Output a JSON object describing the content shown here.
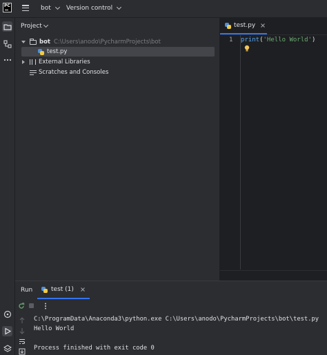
{
  "app": {
    "logo_text": "PC"
  },
  "topbar": {
    "project_name": "bot",
    "vcs_label": "Version control"
  },
  "project_panel": {
    "title": "Project",
    "tree": {
      "root_name": "bot",
      "root_path": "C:\\Users\\anodo\\PycharmProjects\\bot",
      "file_name": "test.py",
      "external_libraries": "External Libraries",
      "scratches": "Scratches and Consoles"
    }
  },
  "editor": {
    "tab_label": "test.py",
    "line_number": "1",
    "code_func": "print",
    "code_open": "(",
    "code_string": "'Hello World'",
    "code_close": ")"
  },
  "run_panel": {
    "tab_title": "Run",
    "run_tab_label": "test (1)",
    "console_lines": [
      "C:\\ProgramData\\Anaconda3\\python.exe C:\\Users\\anodo\\PycharmProjects\\bot\\test.py",
      "Hello World",
      "",
      "Process finished with exit code 0"
    ]
  },
  "colors": {
    "accent": "#3574f0",
    "background": "#1e1f22",
    "panel": "#2b2d30",
    "string": "#6aab73",
    "bulb": "#f2c55c"
  }
}
